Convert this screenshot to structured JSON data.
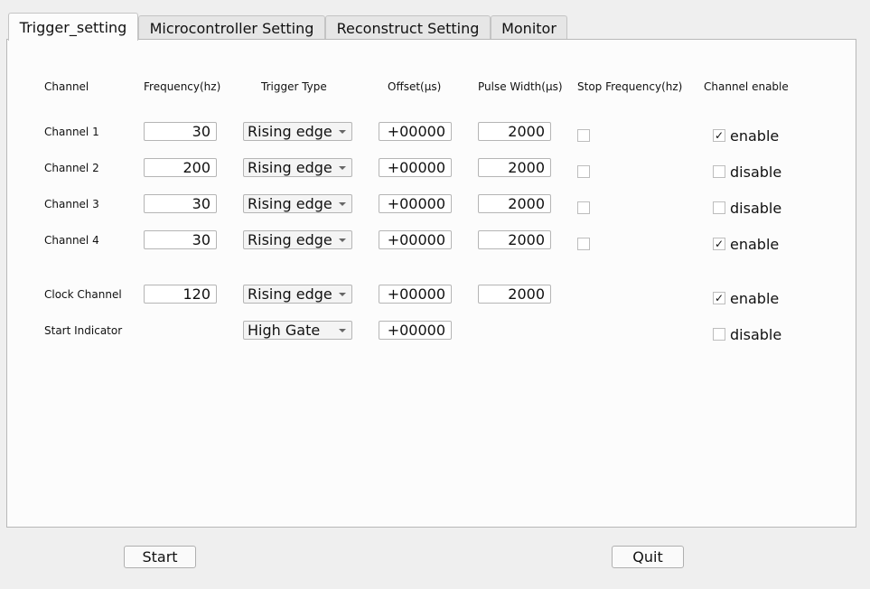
{
  "tabs": [
    {
      "label": "Trigger_setting",
      "active": true
    },
    {
      "label": "Microcontroller Setting"
    },
    {
      "label": "Reconstruct Setting"
    },
    {
      "label": "Monitor"
    }
  ],
  "headers": {
    "channel": "Channel",
    "frequency": "Frequency(hz)",
    "trigger_type": "Trigger Type",
    "offset": "Offset(μs)",
    "pulse_width": "Pulse Width(μs)",
    "stop_frequency": "Stop Frequency(hz)",
    "channel_enable": "Channel enable"
  },
  "rows": [
    {
      "label": "Channel 1",
      "frequency": "30",
      "trigger": "Rising edge",
      "offset": "+00000",
      "pulse": "2000",
      "stop": false,
      "enabled": true,
      "enable_label": "enable"
    },
    {
      "label": "Channel 2",
      "frequency": "200",
      "trigger": "Rising edge",
      "offset": "+00000",
      "pulse": "2000",
      "stop": false,
      "enabled": false,
      "enable_label": "disable"
    },
    {
      "label": "Channel 3",
      "frequency": "30",
      "trigger": "Rising edge",
      "offset": "+00000",
      "pulse": "2000",
      "stop": false,
      "enabled": false,
      "enable_label": "disable"
    },
    {
      "label": "Channel 4",
      "frequency": "30",
      "trigger": "Rising edge",
      "offset": "+00000",
      "pulse": "2000",
      "stop": false,
      "enabled": true,
      "enable_label": "enable"
    },
    {
      "label": "Clock Channel",
      "frequency": "120",
      "trigger": "Rising edge",
      "offset": "+00000",
      "pulse": "2000",
      "enabled": true,
      "enable_label": "enable"
    },
    {
      "label": "Start Indicator",
      "trigger": "High Gate",
      "offset": "+00000",
      "enabled": false,
      "enable_label": "disable"
    }
  ],
  "buttons": {
    "start": "Start",
    "quit": "Quit"
  }
}
